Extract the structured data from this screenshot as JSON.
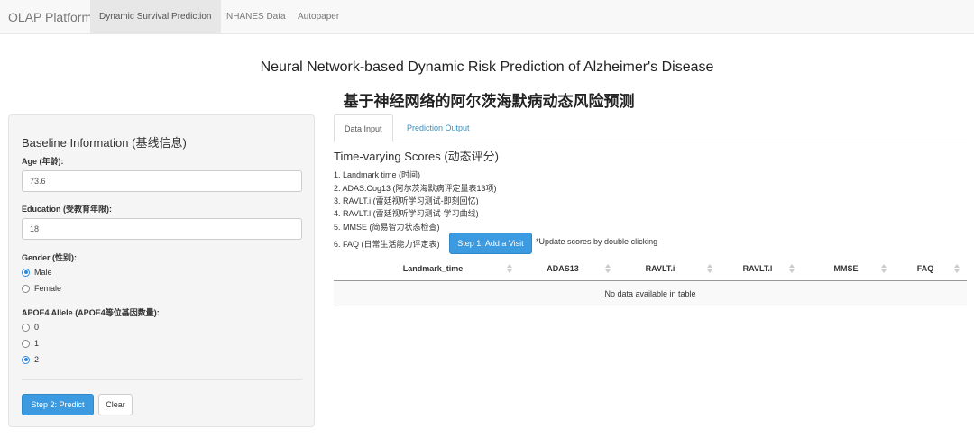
{
  "navbar": {
    "brand": "OLAP Platform",
    "tabs": [
      {
        "label": "Dynamic Survival Prediction",
        "active": true
      },
      {
        "label": "NHANES Data",
        "active": false
      },
      {
        "label": "Autopaper",
        "active": false
      }
    ]
  },
  "page": {
    "title_en": "Neural Network-based Dynamic Risk Prediction of Alzheimer's Disease",
    "title_zh": "基于神经网络的阿尔茨海默病动态风险预测"
  },
  "sidebar": {
    "heading": "Baseline Information (基线信息)",
    "age": {
      "label": "Age (年龄):",
      "value": "73.6"
    },
    "education": {
      "label": "Education (受教育年限):",
      "value": "18"
    },
    "gender": {
      "label": "Gender (性别):",
      "options": [
        {
          "label": "Male",
          "checked": true
        },
        {
          "label": "Female",
          "checked": false
        }
      ]
    },
    "apoe4": {
      "label": "APOE4 Allele (APOE4等位基因数量):",
      "options": [
        {
          "label": "0",
          "checked": false
        },
        {
          "label": "1",
          "checked": false
        },
        {
          "label": "2",
          "checked": true
        }
      ]
    },
    "predict_button": "Step 2: Predict",
    "clear_button": "Clear"
  },
  "main": {
    "tabs": [
      {
        "label": "Data Input",
        "active": true
      },
      {
        "label": "Prediction Output",
        "active": false
      }
    ],
    "section_heading": "Time-varying Scores (动态评分)",
    "list": [
      "1. Landmark time (时间)",
      "2. ADAS.Cog13 (阿尔茨海默病评定量表13项)",
      "3. RAVLT.i (雷廷视听学习测试-即刻回忆)",
      "4. RAVLT.l (雷廷视听学习测试-学习曲线)",
      "5. MMSE (简易智力状态检查)",
      "6. FAQ (日常生活能力评定表)"
    ],
    "add_visit_button": "Step 1: Add a Visit",
    "hint": "*Update scores by double clicking",
    "table": {
      "columns": [
        "Landmark_time",
        "ADAS13",
        "RAVLT.i",
        "RAVLT.l",
        "MMSE",
        "FAQ"
      ],
      "empty_message": "No data available in table"
    }
  },
  "colors": {
    "accent": "#3c9be0",
    "navbar_bg": "#f8f8f8",
    "panel_bg": "#f5f5f5"
  }
}
